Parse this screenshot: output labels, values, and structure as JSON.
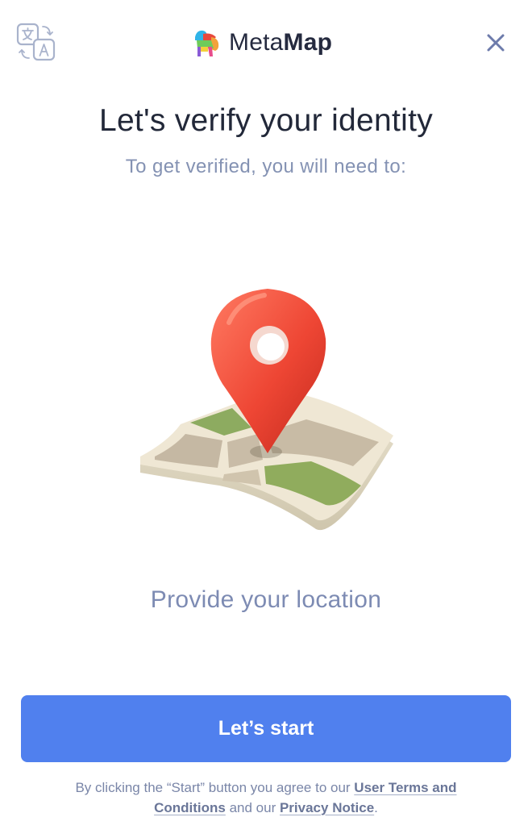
{
  "header": {
    "brand_light": "Meta",
    "brand_bold": "Map",
    "language_icon": "translate-icon",
    "close_icon": "close-icon",
    "logo_icon": "metamap-logo-icon"
  },
  "main": {
    "title": "Let's verify your identity",
    "subtitle": "To get verified, you will need to:",
    "illustration_icon": "map-pin-icon",
    "step_label": "Provide your location"
  },
  "footer": {
    "start_label": "Let’s start",
    "legal_prefix": "By clicking the “Start” button you agree to our ",
    "terms_link": "User Terms and Conditions",
    "legal_middle": " and our ",
    "privacy_link": "Privacy Notice",
    "legal_suffix": "."
  },
  "colors": {
    "accent": "#5080ee",
    "pin": "#ef4b3a",
    "muted_text": "#8492b3"
  }
}
